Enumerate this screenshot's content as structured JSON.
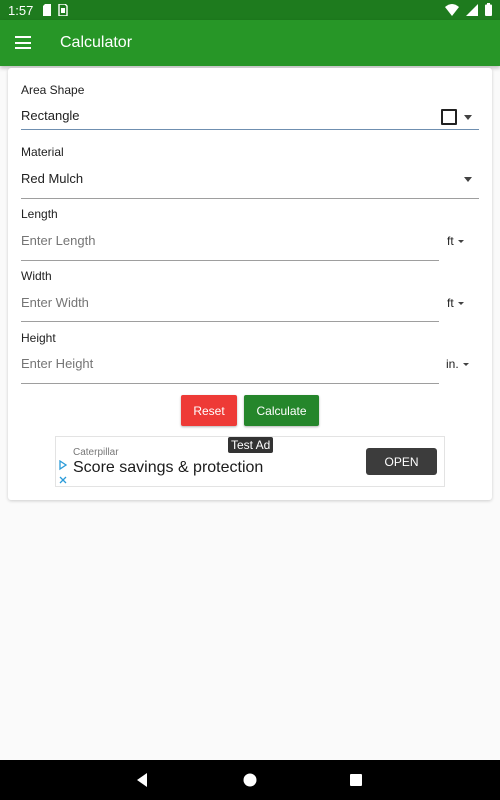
{
  "status_bar": {
    "time": "1:57"
  },
  "app_bar": {
    "title": "Calculator"
  },
  "form": {
    "area_shape": {
      "label": "Area Shape",
      "value": "Rectangle"
    },
    "material": {
      "label": "Material",
      "value": "Red Mulch"
    },
    "length": {
      "label": "Length",
      "placeholder": "Enter Length",
      "unit": "ft"
    },
    "width": {
      "label": "Width",
      "placeholder": "Enter Width",
      "unit": "ft"
    },
    "height": {
      "label": "Height",
      "placeholder": "Enter Height",
      "unit": "in."
    }
  },
  "buttons": {
    "reset": "Reset",
    "calculate": "Calculate"
  },
  "ad": {
    "tag": "Test Ad",
    "advertiser": "Caterpillar",
    "headline": "Score savings & protection",
    "cta": "OPEN"
  },
  "colors": {
    "app_bar": "#279627",
    "status_bar": "#1e7b1e",
    "reset_button": "#ee3a36",
    "calculate_button": "#25862b"
  },
  "icons": [
    "sd-card-icon",
    "sim-icon",
    "wifi-icon",
    "signal-icon",
    "battery-icon",
    "menu-icon",
    "checkbox-icon",
    "adchoices-icon",
    "back-icon",
    "home-icon",
    "recents-icon"
  ]
}
